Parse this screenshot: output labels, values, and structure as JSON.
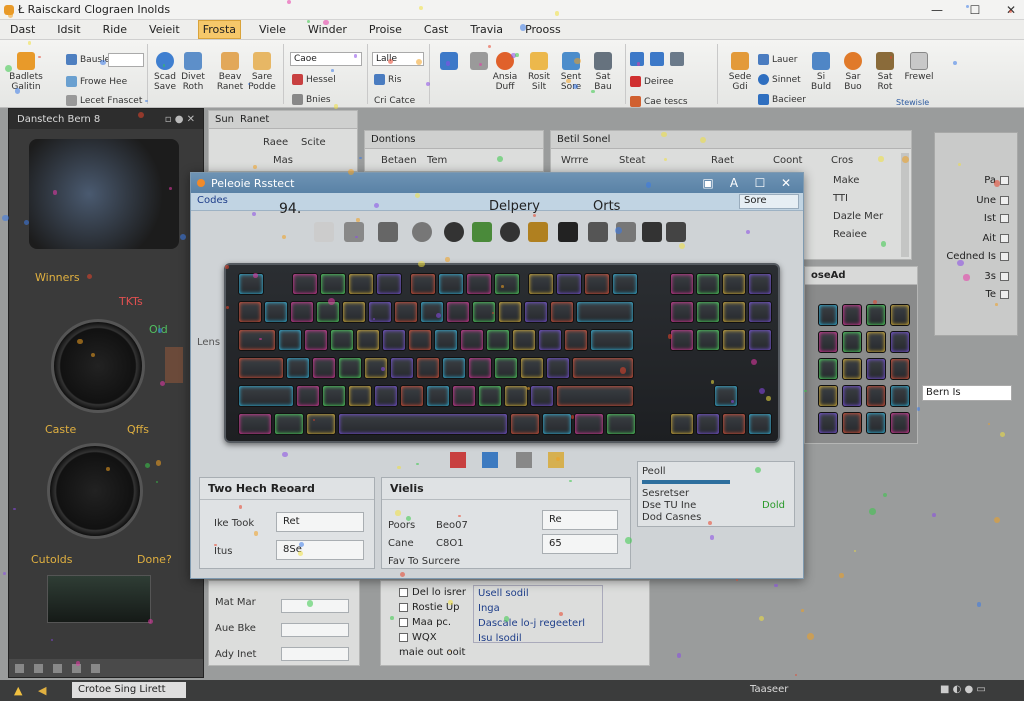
{
  "window": {
    "title": "Ł Raisckard Clograen Inolds",
    "minimize": "—",
    "maximize": "☐",
    "close": "✕"
  },
  "menu": [
    "Dast",
    "Idsit",
    "Ride",
    "Veieit",
    "Frosta",
    "Viele",
    "Winder",
    "Proise",
    "Cast",
    "Travia",
    "Prooss"
  ],
  "menu_active": "Frosta",
  "ribbon": {
    "group1": {
      "btn1": "Badlets\nGalitin",
      "row1": "Bausle",
      "row2": "Frowe Hee",
      "row3": "Lecet Fnascet",
      "btn2": "Scad\nSave",
      "btn3": "Divet\nRoth",
      "btn4": "Beav\nRanet",
      "btn5": "Sare\nPodde"
    },
    "group2": {
      "combo1": "Caoe",
      "row1": "Hessel",
      "row2": "Bnies",
      "combo2": "Lalle",
      "row3": "Ris",
      "row4": "Cri Catce",
      "btn1": "Ansia\nDuff",
      "btn2": "Rosit\nSilt",
      "btn3": "Sent\nSore",
      "btn4": "Sat\nBau"
    },
    "group3": {
      "row1": "Deiree",
      "row2": "Cae tescs",
      "btn1": "Sede\nGdi",
      "row3": "Lauer",
      "row4": "Sinnet",
      "row5": "Bacieer",
      "btn2": "Si\nBuld",
      "btn3": "Sar\nBuo",
      "btn4": "Sat\nRot",
      "btn5": "Frewel",
      "label": "Stewisle"
    }
  },
  "left_panel": {
    "title": "Danstech Bern 8",
    "label_winners": "Winners",
    "label_tkt": "TKTs",
    "label_old": "Old",
    "label_caste": "Caste",
    "label_qffs": "Qffs",
    "label_cutolds": "Cutolds",
    "label_done": "Done?"
  },
  "bg_panels": {
    "top_left": {
      "tab1": "Sun",
      "tab2": "Ranet",
      "row1a": "Raee",
      "row1b": "Scite",
      "row2a": "Mas"
    },
    "top_mid": {
      "title": "Dontions",
      "row1a": "Betaen",
      "row1b": "Tem"
    },
    "top_mid2": {
      "title": "Betil Sonel",
      "c1": "Wrrre",
      "c2": "Steat",
      "r2": "Raet",
      "r3": "Coont",
      "r4": "Cros"
    },
    "right_list": [
      "Make",
      "TTI",
      "Dazle Mer",
      "Reaiee"
    ],
    "right_header": "oseAd",
    "combo_right": "Bern Is",
    "lower": {
      "mat_mar": "Mat Mar",
      "aue_bke": "Aue Bke",
      "ady_inet": "Ady Inet",
      "opts": [
        "Del lo isrer",
        "Rostie Up",
        "Maa pc.",
        "WQX",
        "maie out ooit"
      ],
      "opts2": [
        "Usell sodil",
        "Inga",
        "Dascale lo-j regeeterl",
        "Isu lsodil"
      ]
    }
  },
  "dialog": {
    "title": "Peleoie Rsstect",
    "tab": "Codes",
    "size": "94.",
    "label_delpery": "Delpery",
    "label_orts": "Orts",
    "btn_top_right": "Sore",
    "left_label1": "Lens",
    "two_panel": {
      "title": "Two Hech Reoard",
      "row1_label": "Ike Took",
      "row1_value": "Ret",
      "row2_label": "Itus",
      "row2_value": "8Se"
    },
    "views_panel": {
      "title": "Vielis",
      "rows": [
        "Poors",
        "Cane",
        "Fav To Surcere"
      ],
      "vals": [
        "Beo07",
        "C8O1",
        ""
      ],
      "field1": "Re",
      "field2": "65"
    },
    "right_small": {
      "title": "Peoll",
      "line1": "Sesretser",
      "line2": "Dse TU Ine",
      "line3": "Dod Casnes",
      "ok": "Dold"
    }
  },
  "right_panel": {
    "rows": [
      "Pa",
      "Une",
      "Ist",
      "Ait",
      "Cedned Is",
      "3s",
      "Te"
    ]
  },
  "status": {
    "item1": "Crotoe Sing Lirett",
    "item2": "Taaseer"
  },
  "colors": {
    "dialog_title": "#5a82a6",
    "accent": "#e89a2a",
    "key_glow": "#9ecfe8"
  }
}
